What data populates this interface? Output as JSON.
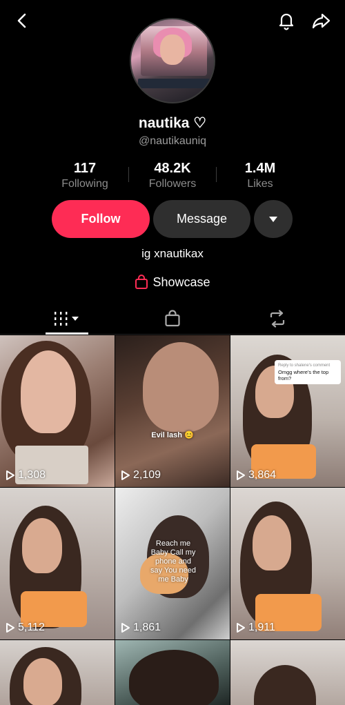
{
  "profile": {
    "name": "nautika ♡",
    "handle": "@nautikauniq",
    "bio": "ig xnautikax",
    "showcase_label": "Showcase"
  },
  "stats": [
    {
      "value": "117",
      "label": "Following"
    },
    {
      "value": "48.2K",
      "label": "Followers"
    },
    {
      "value": "1.4M",
      "label": "Likes"
    }
  ],
  "actions": {
    "follow_label": "Follow",
    "message_label": "Message"
  },
  "tabs": [
    {
      "icon": "grid-icon",
      "active": true
    },
    {
      "icon": "shopping-bag-icon",
      "active": false
    },
    {
      "icon": "repost-icon",
      "active": false
    }
  ],
  "videos": [
    {
      "views": "1,308"
    },
    {
      "views": "2,109",
      "caption": "Evil lash 😊"
    },
    {
      "views": "3,864",
      "comment_header": "Reply to shalene's comment",
      "comment_text": "Omgg where's the top from?"
    },
    {
      "views": "5,112"
    },
    {
      "views": "1,861",
      "overlay": "Reach me Baby Call my phone and say You need me Baby"
    },
    {
      "views": "1,911"
    },
    {
      "views": ""
    },
    {
      "views": ""
    },
    {
      "views": ""
    }
  ],
  "colors": {
    "background": "#000000",
    "follow_button": "#fe2c55",
    "secondary_button": "#2f2f2f",
    "muted_text": "#8d8d8d"
  }
}
